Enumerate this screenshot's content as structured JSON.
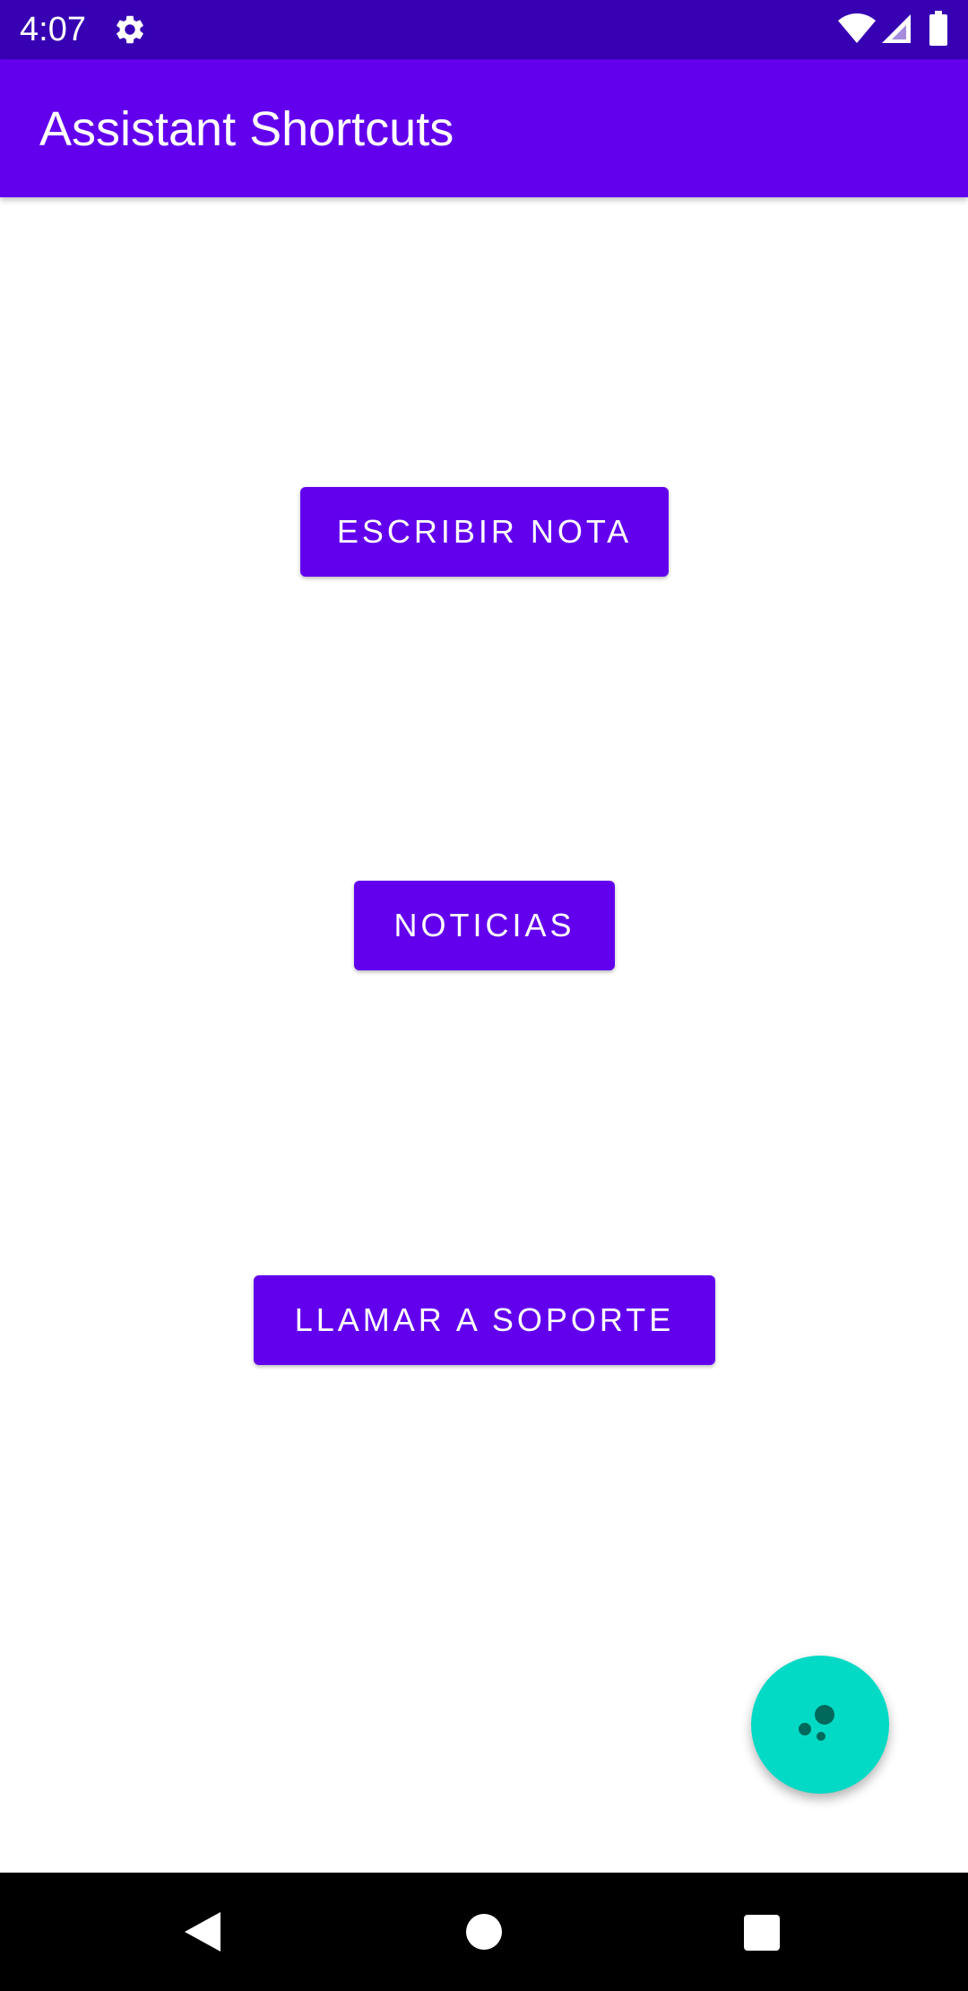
{
  "status_bar": {
    "time": "4:07",
    "icons": [
      "gear-icon",
      "wifi-icon",
      "signal-icon",
      "battery-icon"
    ],
    "background": "#3700b3"
  },
  "app_bar": {
    "title": "Assistant Shortcuts",
    "background": "#6200ee"
  },
  "buttons": [
    {
      "label": "ESCRIBIR NOTA"
    },
    {
      "label": "NOTICIAS"
    },
    {
      "label": "LLAMAR A SOPORTE"
    }
  ],
  "fab": {
    "icon": "assistant-dots-icon",
    "color": "#03dac5"
  },
  "nav_bar": {
    "icons": [
      "back-icon",
      "home-icon",
      "recents-icon"
    ]
  },
  "colors": {
    "primary": "#6200ee",
    "primary_dark": "#3700b3",
    "accent": "#03dac5"
  }
}
